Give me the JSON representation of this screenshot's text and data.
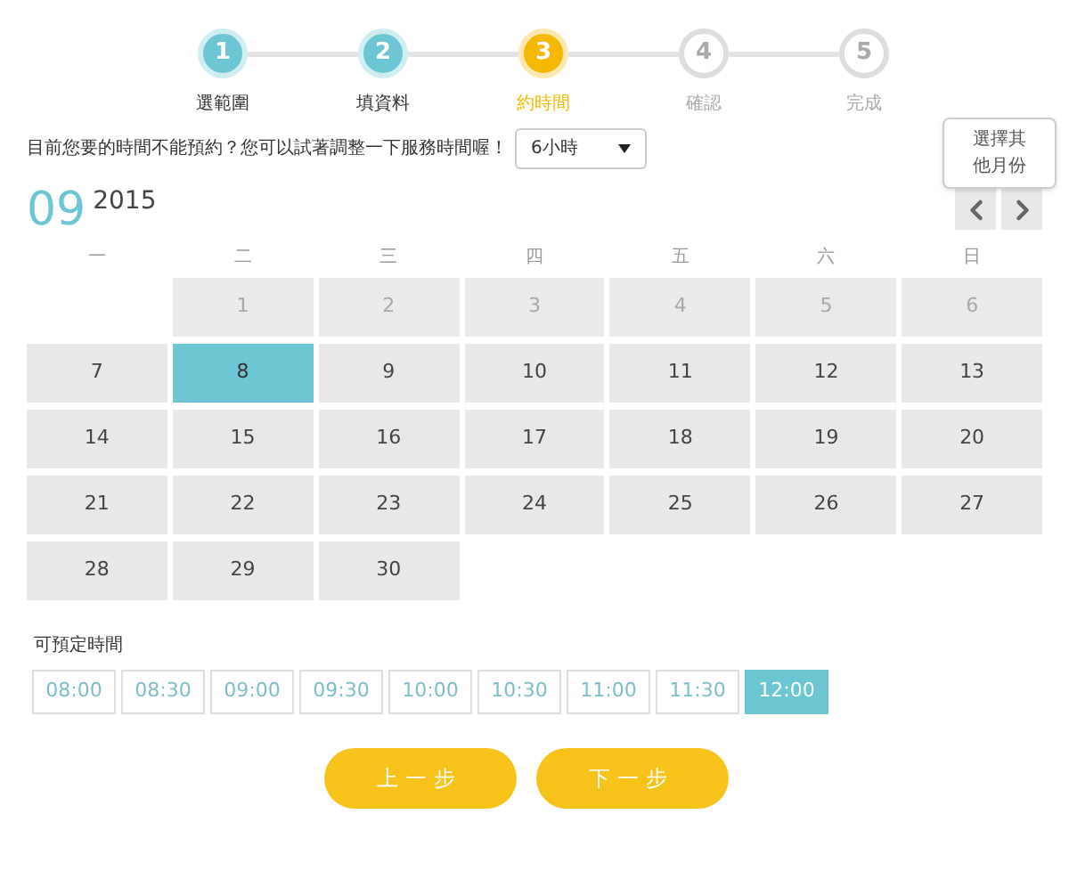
{
  "steps": [
    {
      "number": "1",
      "label": "選範圍",
      "completed": true,
      "current": false
    },
    {
      "number": "2",
      "label": "填資料",
      "completed": true,
      "current": false
    },
    {
      "number": "3",
      "label": "約時間",
      "completed": false,
      "current": true
    },
    {
      "number": "4",
      "label": "確認",
      "completed": false,
      "current": false
    },
    {
      "number": "5",
      "label": "完成",
      "completed": false,
      "current": false
    }
  ],
  "notice": {
    "text": "目前您要的時間不能預約？您可以試著調整一下服務時間喔！",
    "select_value": "6小時"
  },
  "tooltip": "選擇其他月份",
  "calendar": {
    "month": "09",
    "year": "2015",
    "weekdays": [
      "一",
      "二",
      "三",
      "四",
      "五",
      "六",
      "日"
    ],
    "weeks": [
      [
        {
          "kind": "blank"
        },
        {
          "kind": "day",
          "label": "1",
          "disabled": true,
          "selected": false
        },
        {
          "kind": "day",
          "label": "2",
          "disabled": true,
          "selected": false
        },
        {
          "kind": "day",
          "label": "3",
          "disabled": true,
          "selected": false
        },
        {
          "kind": "day",
          "label": "4",
          "disabled": true,
          "selected": false
        },
        {
          "kind": "day",
          "label": "5",
          "disabled": true,
          "selected": false
        },
        {
          "kind": "day",
          "label": "6",
          "disabled": true,
          "selected": false
        }
      ],
      [
        {
          "kind": "day",
          "label": "7",
          "disabled": false,
          "selected": false
        },
        {
          "kind": "day",
          "label": "8",
          "disabled": false,
          "selected": true
        },
        {
          "kind": "day",
          "label": "9",
          "disabled": false,
          "selected": false
        },
        {
          "kind": "day",
          "label": "10",
          "disabled": false,
          "selected": false
        },
        {
          "kind": "day",
          "label": "11",
          "disabled": false,
          "selected": false
        },
        {
          "kind": "day",
          "label": "12",
          "disabled": false,
          "selected": false
        },
        {
          "kind": "day",
          "label": "13",
          "disabled": false,
          "selected": false
        }
      ],
      [
        {
          "kind": "day",
          "label": "14",
          "disabled": false,
          "selected": false
        },
        {
          "kind": "day",
          "label": "15",
          "disabled": false,
          "selected": false
        },
        {
          "kind": "day",
          "label": "16",
          "disabled": false,
          "selected": false
        },
        {
          "kind": "day",
          "label": "17",
          "disabled": false,
          "selected": false
        },
        {
          "kind": "day",
          "label": "18",
          "disabled": false,
          "selected": false
        },
        {
          "kind": "day",
          "label": "19",
          "disabled": false,
          "selected": false
        },
        {
          "kind": "day",
          "label": "20",
          "disabled": false,
          "selected": false
        }
      ],
      [
        {
          "kind": "day",
          "label": "21",
          "disabled": false,
          "selected": false
        },
        {
          "kind": "day",
          "label": "22",
          "disabled": false,
          "selected": false
        },
        {
          "kind": "day",
          "label": "23",
          "disabled": false,
          "selected": false
        },
        {
          "kind": "day",
          "label": "24",
          "disabled": false,
          "selected": false
        },
        {
          "kind": "day",
          "label": "25",
          "disabled": false,
          "selected": false
        },
        {
          "kind": "day",
          "label": "26",
          "disabled": false,
          "selected": false
        },
        {
          "kind": "day",
          "label": "27",
          "disabled": false,
          "selected": false
        }
      ],
      [
        {
          "kind": "day",
          "label": "28",
          "disabled": false,
          "selected": false
        },
        {
          "kind": "day",
          "label": "29",
          "disabled": false,
          "selected": false
        },
        {
          "kind": "day",
          "label": "30",
          "disabled": false,
          "selected": false
        }
      ]
    ]
  },
  "times": {
    "title": "可預定時間",
    "slots": [
      {
        "label": "08:00",
        "selected": false
      },
      {
        "label": "08:30",
        "selected": false
      },
      {
        "label": "09:00",
        "selected": false
      },
      {
        "label": "09:30",
        "selected": false
      },
      {
        "label": "10:00",
        "selected": false
      },
      {
        "label": "10:30",
        "selected": false
      },
      {
        "label": "11:00",
        "selected": false
      },
      {
        "label": "11:30",
        "selected": false
      },
      {
        "label": "12:00",
        "selected": true
      }
    ]
  },
  "buttons": [
    "上一步",
    "下一步"
  ]
}
